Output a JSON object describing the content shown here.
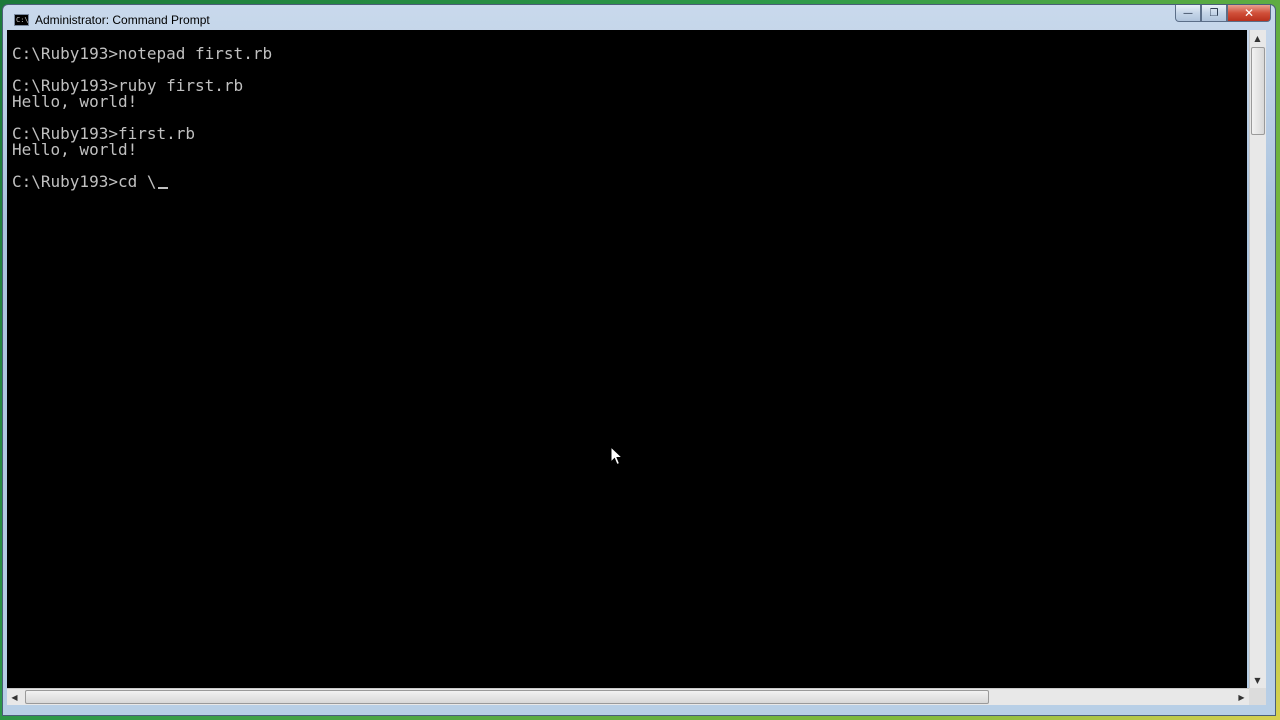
{
  "window": {
    "title": "Administrator: Command Prompt",
    "icon": "command-prompt-icon",
    "icon_glyph": "C:\\"
  },
  "caption_buttons": {
    "minimize_glyph": "—",
    "maximize_glyph": "❐",
    "close_glyph": "✕"
  },
  "console": {
    "lines": [
      "C:\\Ruby193>notepad first.rb",
      "",
      "C:\\Ruby193>ruby first.rb",
      "Hello, world!",
      "",
      "C:\\Ruby193>first.rb",
      "Hello, world!",
      "",
      "C:\\Ruby193>cd \\"
    ],
    "foreground_color": "#c0c0c0",
    "background_color": "#000000"
  },
  "scrollbars": {
    "up_arrow": "▲",
    "down_arrow": "▼",
    "left_arrow": "◀",
    "right_arrow": "▶"
  }
}
